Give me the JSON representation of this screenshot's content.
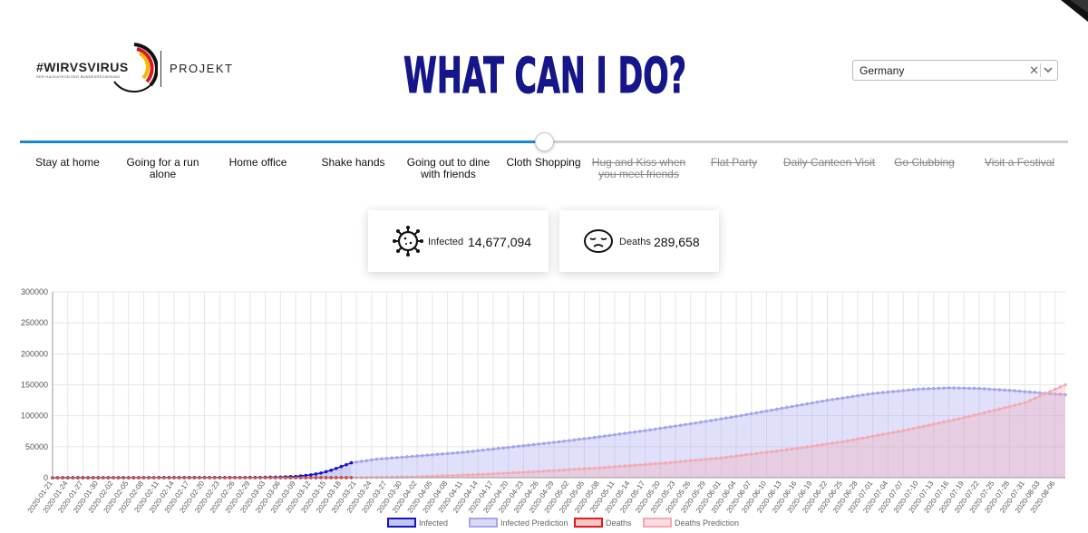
{
  "header": {
    "logo_text": "#WIRVSVIRUS",
    "logo_subtitle": "DER HACKATHON DER BUNDESREGIERUNG",
    "logo_projekt": "PROJEKT",
    "title": "WHAT CAN I DO?"
  },
  "country_select": {
    "value": "Germany"
  },
  "timeline": {
    "progress": 0.5,
    "steps": [
      {
        "label": "Stay at home",
        "active": true
      },
      {
        "label": "Going for a run alone",
        "active": true
      },
      {
        "label": "Home office",
        "active": true
      },
      {
        "label": "Shake hands",
        "active": true
      },
      {
        "label": "Going out to dine with friends",
        "active": true
      },
      {
        "label": "Cloth Shopping",
        "active": true
      },
      {
        "label": "Hug and Kiss when you meet friends",
        "active": false
      },
      {
        "label": "Flat Party",
        "active": false
      },
      {
        "label": "Daily Canteen Visit",
        "active": false
      },
      {
        "label": "Go Clubbing",
        "active": false
      },
      {
        "label": "Visit a Festival",
        "active": false
      }
    ]
  },
  "stats": {
    "infected_label": "Infected",
    "infected_value": "14,677,094",
    "infected_icon": "virus-icon",
    "deaths_label": "Deaths",
    "deaths_value": "289,658",
    "deaths_icon": "sad-face-icon"
  },
  "colors": {
    "accent": "#1b86d3",
    "infected": "#1515c8",
    "infected_prediction": "#a5a5f0",
    "deaths": "#e01c1c",
    "deaths_prediction": "#f4aab2"
  },
  "chart_data": {
    "type": "area",
    "title": "",
    "xlabel": "",
    "ylabel": "",
    "ylim": [
      0,
      300000
    ],
    "yticks": [
      0,
      50000,
      100000,
      150000,
      200000,
      250000,
      300000
    ],
    "grid": true,
    "legend_position": "bottom",
    "x_start": "2020-01-21",
    "x_end": "2020-08-08",
    "x_tick_labels": [
      "2020-01-21",
      "2020-01-24",
      "2020-01-27",
      "2020-01-30",
      "2020-02-02",
      "2020-02-05",
      "2020-02-08",
      "2020-02-11",
      "2020-02-14",
      "2020-02-17",
      "2020-02-20",
      "2020-02-23",
      "2020-02-26",
      "2020-02-29",
      "2020-03-03",
      "2020-03-06",
      "2020-03-09",
      "2020-03-12",
      "2020-03-15",
      "2020-03-18",
      "2020-03-21",
      "2020-03-24",
      "2020-03-27",
      "2020-03-30",
      "2020-04-02",
      "2020-04-05",
      "2020-04-08",
      "2020-04-11",
      "2020-04-14",
      "2020-04-17",
      "2020-04-20",
      "2020-04-23",
      "2020-04-26",
      "2020-04-29",
      "2020-05-02",
      "2020-05-05",
      "2020-05-08",
      "2020-05-11",
      "2020-05-14",
      "2020-05-17",
      "2020-05-20",
      "2020-05-23",
      "2020-05-26",
      "2020-05-29",
      "2020-06-01",
      "2020-06-04",
      "2020-06-07",
      "2020-06-10",
      "2020-06-13",
      "2020-06-16",
      "2020-06-19",
      "2020-06-22",
      "2020-06-25",
      "2020-06-28",
      "2020-07-01",
      "2020-07-04",
      "2020-07-07",
      "2020-07-10",
      "2020-07-13",
      "2020-07-16",
      "2020-07-19",
      "2020-07-22",
      "2020-07-25",
      "2020-07-28",
      "2020-07-31",
      "2020-08-03",
      "2020-08-06"
    ],
    "series": [
      {
        "name": "Infected",
        "color": "#1515c8",
        "x": [
          "2020-01-21",
          "2020-03-01",
          "2020-03-06",
          "2020-03-09",
          "2020-03-12",
          "2020-03-14",
          "2020-03-16",
          "2020-03-18",
          "2020-03-20"
        ],
        "y": [
          0,
          400,
          1000,
          2000,
          4500,
          7500,
          12000,
          18000,
          24000
        ]
      },
      {
        "name": "Infected Prediction",
        "color": "#a5a5f0",
        "x": [
          "2020-03-20",
          "2020-03-25",
          "2020-04-02",
          "2020-04-11",
          "2020-04-20",
          "2020-04-29",
          "2020-05-08",
          "2020-05-17",
          "2020-05-26",
          "2020-06-04",
          "2020-06-13",
          "2020-06-22",
          "2020-07-01",
          "2020-07-10",
          "2020-07-16",
          "2020-07-22",
          "2020-07-28",
          "2020-08-03",
          "2020-08-08"
        ],
        "y": [
          24000,
          30000,
          35000,
          41000,
          49000,
          57000,
          66000,
          76000,
          87000,
          99000,
          112000,
          125000,
          136000,
          143000,
          145000,
          144000,
          141000,
          137000,
          134000
        ]
      },
      {
        "name": "Deaths",
        "color": "#e01c1c",
        "x": [
          "2020-01-21",
          "2020-03-10",
          "2020-03-15",
          "2020-03-20"
        ],
        "y": [
          0,
          0,
          50,
          100
        ]
      },
      {
        "name": "Deaths Prediction",
        "color": "#f4aab2",
        "x": [
          "2020-03-20",
          "2020-04-02",
          "2020-04-14",
          "2020-04-26",
          "2020-05-08",
          "2020-05-20",
          "2020-06-01",
          "2020-06-13",
          "2020-06-25",
          "2020-07-07",
          "2020-07-19",
          "2020-07-31",
          "2020-08-08"
        ],
        "y": [
          100,
          1500,
          5000,
          10000,
          16000,
          23000,
          32000,
          44000,
          58000,
          76000,
          97000,
          121000,
          150000
        ]
      }
    ]
  }
}
